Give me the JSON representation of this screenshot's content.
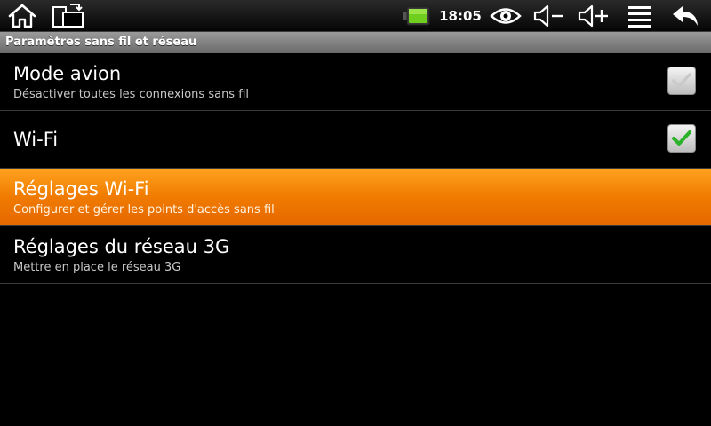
{
  "status_bar": {
    "time": "18:05",
    "icons": [
      "home-icon",
      "screen-rotate-icon",
      "battery-icon",
      "eye-icon",
      "volume-down-icon",
      "volume-up-icon",
      "menu-icon",
      "back-icon"
    ]
  },
  "header": {
    "title": "Paramètres sans fil et réseau"
  },
  "settings": {
    "items": [
      {
        "title": "Mode avion",
        "summary": "Désactiver toutes les connexions sans fil",
        "checkbox": true,
        "checked": false
      },
      {
        "title": "Wi-Fi",
        "summary": "",
        "checkbox": true,
        "checked": true
      },
      {
        "title": "Réglages Wi-Fi",
        "summary": "Configurer et gérer les points d'accès sans fil",
        "selected": true
      },
      {
        "title": "Réglages du réseau 3G",
        "summary": "Mettre en place le réseau 3G"
      }
    ]
  },
  "colors": {
    "highlight": "#f07b00",
    "check": "#2bb22b",
    "battery": "#6fce1e"
  }
}
